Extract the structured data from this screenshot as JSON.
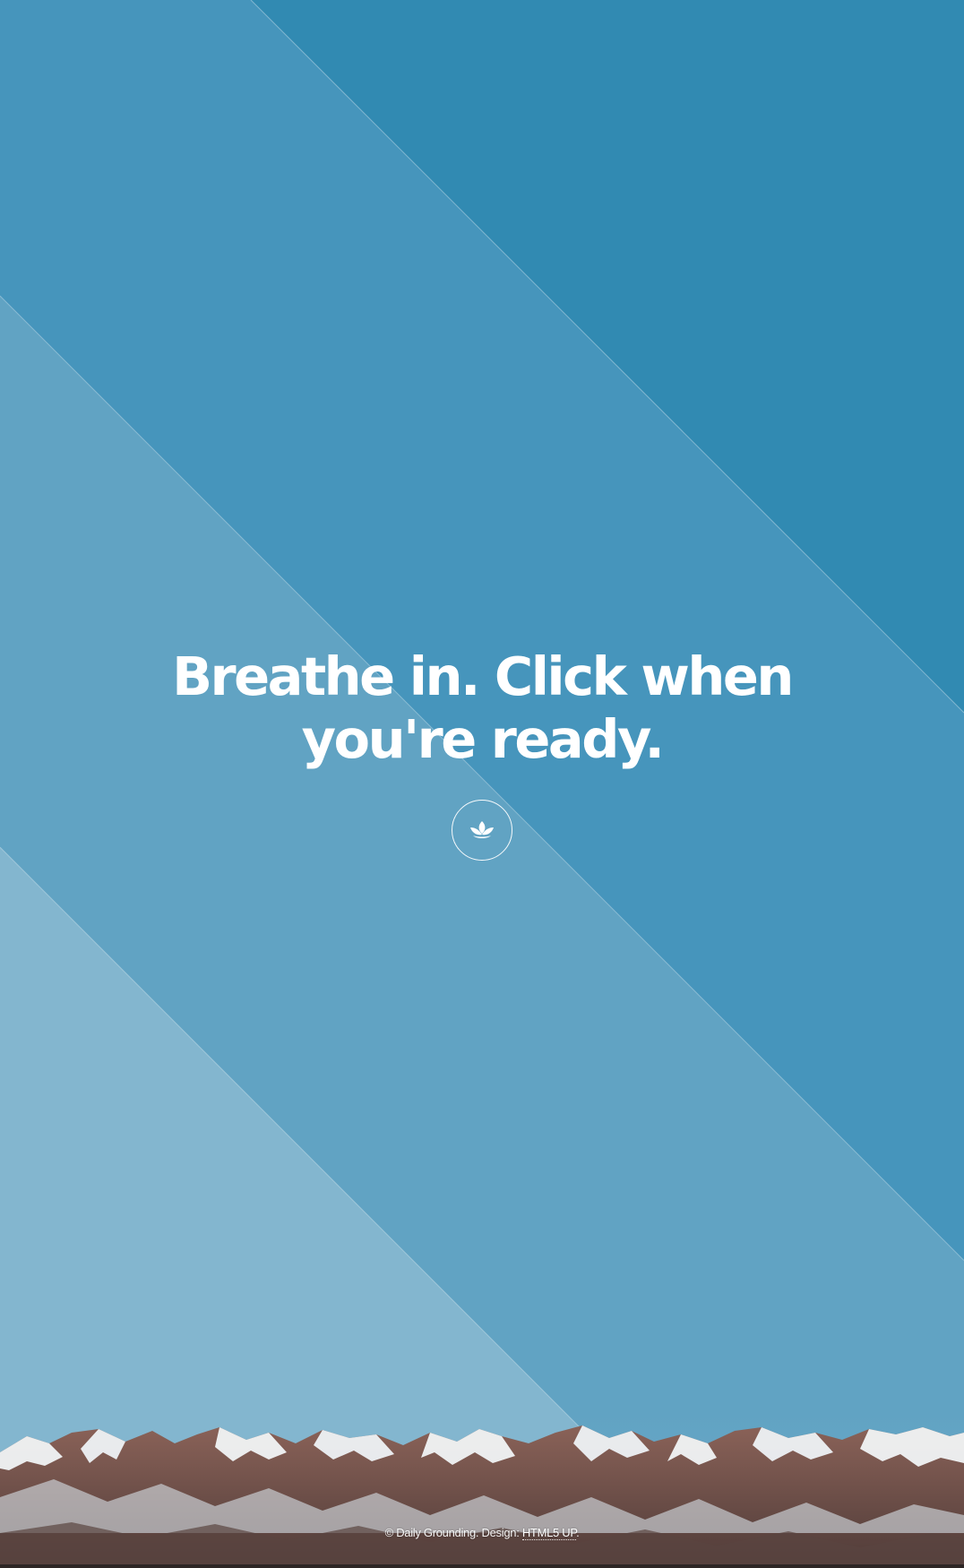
{
  "hero": {
    "headline": "Breathe in. Click when you're ready.",
    "button_icon": "lotus-icon"
  },
  "footer": {
    "copyright": "© Daily Grounding. Design: ",
    "link_label": "HTML5 UP",
    "trailing": "."
  },
  "colors": {
    "background": "#318ab2",
    "band_mid": "#4796bc",
    "band_light": "#63a5c4",
    "band_lightest": "#84b7cf",
    "text": "#ffffff"
  }
}
